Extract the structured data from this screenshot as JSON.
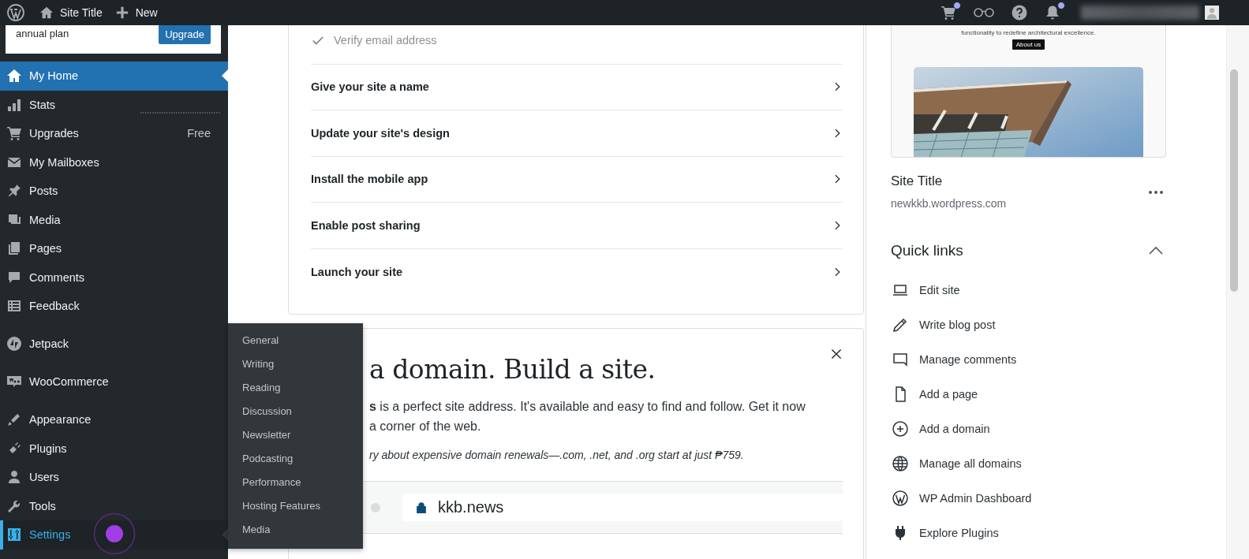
{
  "top_bar": {
    "site_title": "Site Title",
    "new_label": "New",
    "cart_notice": true,
    "notifications_notice": true
  },
  "sidebar": {
    "banner": {
      "text": "annual plan",
      "button": "Upgrade"
    },
    "groups": [
      [
        {
          "label": "My Home",
          "selected": true,
          "expanded": false
        },
        {
          "label": "Stats",
          "selected": false,
          "expanded": false,
          "sparkline": true
        },
        {
          "label": "Upgrades",
          "selected": false,
          "expanded": false,
          "badge": "Free"
        },
        {
          "label": "My Mailboxes",
          "selected": false,
          "expanded": false
        },
        {
          "label": "Posts",
          "selected": false,
          "expanded": false
        },
        {
          "label": "Media",
          "selected": false,
          "expanded": false
        },
        {
          "label": "Pages",
          "selected": false,
          "expanded": false
        },
        {
          "label": "Comments",
          "selected": false,
          "expanded": false
        },
        {
          "label": "Feedback",
          "selected": false,
          "expanded": false
        }
      ],
      [
        {
          "label": "Jetpack",
          "selected": false,
          "expanded": false
        }
      ],
      [
        {
          "label": "WooCommerce",
          "selected": false,
          "expanded": false
        }
      ],
      [
        {
          "label": "Appearance",
          "selected": false,
          "expanded": false
        },
        {
          "label": "Plugins",
          "selected": false,
          "expanded": false
        },
        {
          "label": "Users",
          "selected": false,
          "expanded": false
        },
        {
          "label": "Tools",
          "selected": false,
          "expanded": false
        },
        {
          "label": "Settings",
          "selected": false,
          "expanded": true
        }
      ]
    ],
    "flyout": [
      "General",
      "Writing",
      "Reading",
      "Discussion",
      "Newsletter",
      "Podcasting",
      "Performance",
      "Hosting Features",
      "Media"
    ]
  },
  "checklist": [
    {
      "label": "Verify email address",
      "completed": true
    },
    {
      "label": "Give your site a name",
      "completed": false
    },
    {
      "label": "Update your site's design",
      "completed": false
    },
    {
      "label": "Install the mobile app",
      "completed": false
    },
    {
      "label": "Enable post sharing",
      "completed": false
    },
    {
      "label": "Launch your site",
      "completed": false
    }
  ],
  "domain_card": {
    "heading": "a domain. Build a site.",
    "lines": [
      "**s** is a perfect site address. It's available and easy to find and follow. Get it now",
      "a corner of the web."
    ],
    "note": "ry about expensive domain renewals—.com, .net, and .org start at just ₱759.",
    "domain": "kkb.news"
  },
  "site_panel": {
    "preview": {
      "tagline": "functionality to redefine architectural excellence.",
      "button": "About us"
    },
    "title": "Site Title",
    "url": "newkkb.wordpress.com",
    "quick_links": {
      "title": "Quick links",
      "expanded": true,
      "items": [
        "Edit site",
        "Write blog post",
        "Manage comments",
        "Add a page",
        "Add a domain",
        "Manage all domains",
        "WP Admin Dashboard",
        "Explore Plugins"
      ]
    }
  }
}
